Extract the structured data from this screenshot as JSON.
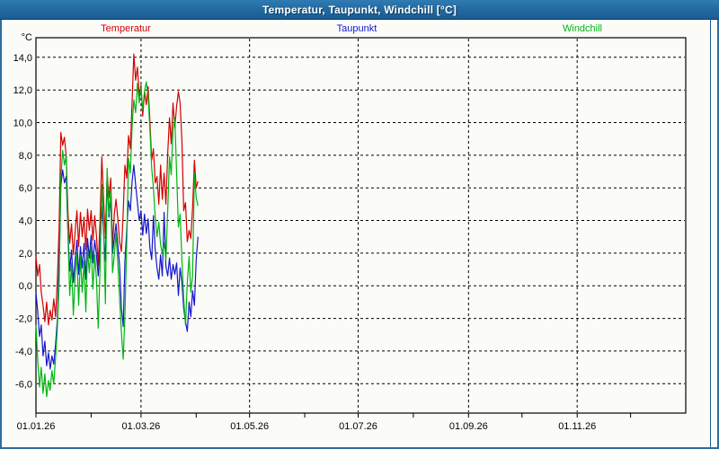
{
  "window": {
    "title": "Temperatur, Taupunkt, Windchill [°C]"
  },
  "legend": [
    {
      "label": "Temperatur",
      "color": "#d40000"
    },
    {
      "label": "Taupunkt",
      "color": "#1616cc"
    },
    {
      "label": "Windchill",
      "color": "#00b414"
    }
  ],
  "chart_data": {
    "type": "line",
    "title": "Temperatur, Taupunkt, Windchill [°C]",
    "legend_position": "top",
    "grid": "dashed",
    "y_axis": {
      "unit_label": "°C",
      "min": -7.8,
      "max": 15.2,
      "ticks": [
        {
          "v": 14,
          "label": "14,0"
        },
        {
          "v": 12,
          "label": "12,0"
        },
        {
          "v": 10,
          "label": "10,0"
        },
        {
          "v": 8,
          "label": "8,0"
        },
        {
          "v": 6,
          "label": "6,0"
        },
        {
          "v": 4,
          "label": "4,0"
        },
        {
          "v": 2,
          "label": "2,0"
        },
        {
          "v": 0,
          "label": "0,0"
        },
        {
          "v": -2,
          "label": "-2,0"
        },
        {
          "v": -4,
          "label": "-4,0"
        },
        {
          "v": -6,
          "label": "-6,0"
        }
      ]
    },
    "x_axis": {
      "span_days": 365,
      "months": [
        {
          "day": 0,
          "label": "01.01.26",
          "grid": false
        },
        {
          "day": 31,
          "grid": false
        },
        {
          "day": 59,
          "label": "01.03.26",
          "grid": true
        },
        {
          "day": 90,
          "grid": false
        },
        {
          "day": 120,
          "label": "01.05.26",
          "grid": true
        },
        {
          "day": 151,
          "grid": false
        },
        {
          "day": 181,
          "label": "01.07.26",
          "grid": true
        },
        {
          "day": 212,
          "grid": false
        },
        {
          "day": 243,
          "label": "01.09.26",
          "grid": true
        },
        {
          "day": 273,
          "grid": false
        },
        {
          "day": 304,
          "label": "01.11.26",
          "grid": true
        },
        {
          "day": 334,
          "grid": false
        }
      ]
    },
    "series": [
      {
        "name": "Temperatur",
        "color": "#d40000",
        "x_start_day": 0,
        "x_step_days": 1,
        "values": [
          1.8,
          0.6,
          1.3,
          -0.4,
          -1.2,
          -2.2,
          -1.0,
          -2.4,
          -1.5,
          -2.1,
          -0.8,
          -1.9,
          0.3,
          3.6,
          9.4,
          8.6,
          9.1,
          7.9,
          4.4,
          2.6,
          3.8,
          1.9,
          3.3,
          4.6,
          2.4,
          4.5,
          3.0,
          4.2,
          2.2,
          4.7,
          3.4,
          4.6,
          2.8,
          4.3,
          3.1,
          1.2,
          4.0,
          7.9,
          5.2,
          2.9,
          6.9,
          5.4,
          6.6,
          2.5,
          4.4,
          5.3,
          4.1,
          2.7,
          2.1,
          4.5,
          7.4,
          6.6,
          9.2,
          8.4,
          11.3,
          14.2,
          12.6,
          13.4,
          11.6,
          12.3,
          10.4,
          11.9,
          11.1,
          12.2,
          10.1,
          7.7,
          8.4,
          6.3,
          6.7,
          5.0,
          7.4,
          5.3,
          6.9,
          5.0,
          8.1,
          10.3,
          8.7,
          11.2,
          9.7,
          11.0,
          11.9,
          11.2,
          8.9,
          4.6,
          5.1,
          2.7,
          3.4,
          2.9,
          4.8,
          7.7,
          6.0,
          6.4
        ]
      },
      {
        "name": "Taupunkt",
        "color": "#1616cc",
        "x_start_day": 0,
        "x_step_days": 1,
        "values": [
          -0.4,
          -1.6,
          -3.1,
          -2.4,
          -4.3,
          -3.4,
          -4.9,
          -4.1,
          -5.1,
          -4.3,
          -4.8,
          -3.6,
          -2.1,
          1.4,
          6.1,
          7.1,
          6.3,
          6.7,
          3.1,
          0.9,
          2.2,
          0.2,
          1.6,
          2.8,
          0.7,
          2.4,
          1.1,
          2.6,
          0.4,
          2.9,
          1.7,
          3.1,
          1.4,
          2.8,
          1.9,
          0.6,
          2.3,
          4.9,
          3.2,
          1.5,
          6.7,
          4.2,
          5.4,
          2.0,
          2.9,
          3.8,
          2.5,
          1.2,
          -1.4,
          -2.5,
          1.5,
          3.4,
          5.2,
          4.6,
          6.4,
          7.4,
          6.2,
          5.1,
          4.0,
          4.6,
          3.1,
          4.4,
          3.2,
          4.1,
          2.3,
          1.6,
          4.3,
          2.2,
          1.1,
          0.4,
          1.9,
          0.6,
          4.5,
          1.2,
          0.6,
          1.7,
          0.4,
          1.3,
          0.7,
          1.4,
          -0.6,
          1.1,
          0.2,
          -1.4,
          -2.2,
          -2.8,
          -1.0,
          -1.9,
          -0.3,
          -1.2,
          1.6,
          3.0
        ]
      },
      {
        "name": "Windchill",
        "color": "#00b414",
        "x_start_day": 0,
        "x_step_days": 1,
        "values": [
          -2.4,
          -4.6,
          -6.2,
          -5.0,
          -6.6,
          -5.4,
          -6.8,
          -5.8,
          -6.4,
          -5.2,
          -6.0,
          -4.4,
          -2.6,
          0.2,
          6.6,
          8.3,
          7.4,
          8.0,
          2.9,
          -0.6,
          1.4,
          -1.8,
          0.6,
          2.0,
          -1.2,
          1.8,
          -0.4,
          1.5,
          -1.6,
          2.2,
          0.8,
          2.4,
          -0.2,
          1.9,
          0.4,
          -2.6,
          1.0,
          6.2,
          3.4,
          -1.1,
          7.2,
          4.4,
          5.8,
          0.8,
          1.9,
          3.2,
          1.4,
          -0.8,
          -2.9,
          -4.5,
          -1.8,
          2.6,
          7.8,
          6.9,
          9.8,
          11.4,
          10.6,
          12.4,
          11.2,
          12.1,
          10.8,
          11.9,
          12.5,
          11.6,
          9.6,
          7.2,
          6.0,
          4.2,
          3.0,
          3.9,
          2.5,
          2.0,
          2.6,
          1.6,
          4.6,
          7.9,
          6.8,
          9.6,
          10.3,
          6.9,
          3.6,
          4.4,
          1.6,
          -0.8,
          -2.4,
          0.2,
          1.8,
          -0.4,
          0.6,
          6.9,
          5.4,
          4.9
        ]
      }
    ]
  }
}
